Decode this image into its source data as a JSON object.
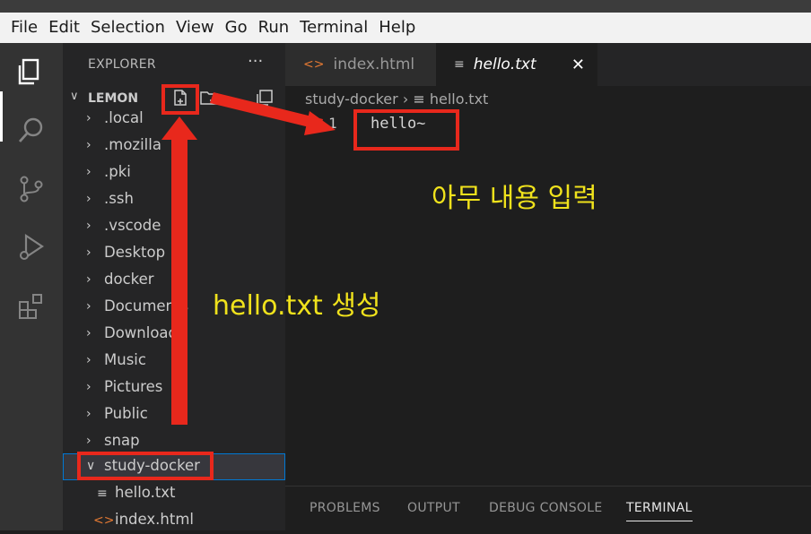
{
  "menubar": {
    "items": [
      "File",
      "Edit",
      "Selection",
      "View",
      "Go",
      "Run",
      "Terminal",
      "Help"
    ]
  },
  "activity_bar": {
    "icons": [
      "explorer-icon",
      "search-icon",
      "source-control-icon",
      "run-debug-icon",
      "extensions-icon"
    ]
  },
  "sidebar": {
    "header": "EXPLORER",
    "more": "···",
    "root": "LEMON",
    "root_actions": [
      "new-file-icon",
      "new-folder-icon",
      "collapse-icon"
    ],
    "items": [
      {
        "label": ".local",
        "type": "folder"
      },
      {
        "label": ".mozilla",
        "type": "folder"
      },
      {
        "label": ".pki",
        "type": "folder"
      },
      {
        "label": ".ssh",
        "type": "folder"
      },
      {
        "label": ".vscode",
        "type": "folder"
      },
      {
        "label": "Desktop",
        "type": "folder"
      },
      {
        "label": "docker",
        "type": "folder"
      },
      {
        "label": "Documents",
        "type": "folder"
      },
      {
        "label": "Downloads",
        "type": "folder"
      },
      {
        "label": "Music",
        "type": "folder"
      },
      {
        "label": "Pictures",
        "type": "folder"
      },
      {
        "label": "Public",
        "type": "folder"
      },
      {
        "label": "snap",
        "type": "folder"
      },
      {
        "label": "study-docker",
        "type": "folder-open",
        "selected": true
      },
      {
        "label": "hello.txt",
        "type": "file-txt"
      },
      {
        "label": "index.html",
        "type": "file-html"
      }
    ]
  },
  "tabs": [
    {
      "label": "index.html",
      "icon": "html-file-icon",
      "active": false
    },
    {
      "label": "hello.txt",
      "icon": "text-file-icon",
      "active": true,
      "close": "✕"
    }
  ],
  "breadcrumb": {
    "folder": "study-docker",
    "separator": "›",
    "file": "hello.txt"
  },
  "editor": {
    "line_number": "1",
    "line_text": "hello~"
  },
  "panel": {
    "tabs": [
      "PROBLEMS",
      "OUTPUT",
      "DEBUG CONSOLE",
      "TERMINAL"
    ],
    "active": "TERMINAL"
  },
  "annotations": {
    "input_note": "아무 내용 입력",
    "create_note": "hello.txt 생성",
    "color": "#e8281c",
    "text_color": "#f0e21c"
  }
}
